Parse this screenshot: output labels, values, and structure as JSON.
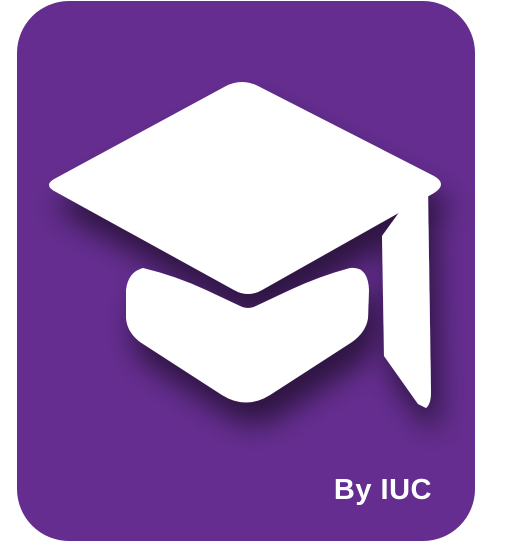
{
  "icon": {
    "name": "graduation-cap-icon",
    "colors": {
      "background": "#642d8f",
      "foreground": "#ffffff",
      "shadow": "#3a1a55"
    }
  },
  "caption": {
    "text": "By IUC"
  }
}
